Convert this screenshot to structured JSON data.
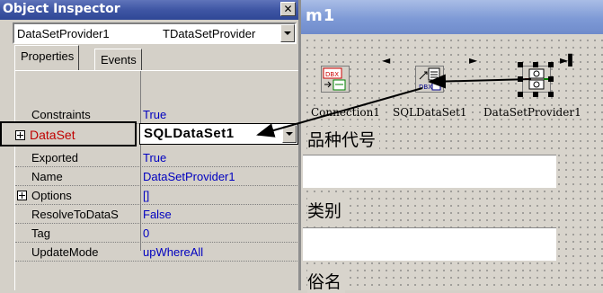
{
  "form": {
    "title_fragment": "m1",
    "components": [
      {
        "label": "Connection1",
        "icon": "dbx-connection-icon"
      },
      {
        "label": "SQLDataSet1",
        "icon": "dbx-dataset-icon"
      },
      {
        "label": "DataSetProvider1",
        "icon": "dataset-provider-icon"
      }
    ],
    "labels": [
      "品种代号",
      "类别",
      "俗名"
    ]
  },
  "inspector": {
    "title": "Object Inspector",
    "close_glyph": "✕",
    "object_name": "DataSetProvider1",
    "object_type": "TDataSetProvider",
    "tabs": [
      "Properties",
      "Events"
    ],
    "properties": [
      {
        "name": "Constraints",
        "value": "True",
        "expandable": false
      },
      {
        "name": "DataSet",
        "value": "SQLDataSet1",
        "expandable": true,
        "selected": true
      },
      {
        "name": "Exported",
        "value": "True",
        "expandable": false
      },
      {
        "name": "Name",
        "value": "DataSetProvider1",
        "expandable": false
      },
      {
        "name": "Options",
        "value": "[]",
        "expandable": true
      },
      {
        "name": "ResolveToDataS",
        "value": "False",
        "expandable": false
      },
      {
        "name": "Tag",
        "value": "0",
        "expandable": false
      },
      {
        "name": "UpdateMode",
        "value": "upWhereAll",
        "expandable": false
      }
    ]
  },
  "colors": {
    "selected_property": "#c00000",
    "property_value": "#0000c0",
    "inspector_title_bg": "#3f56a4",
    "form_title_bg": "#7e9ad6"
  }
}
